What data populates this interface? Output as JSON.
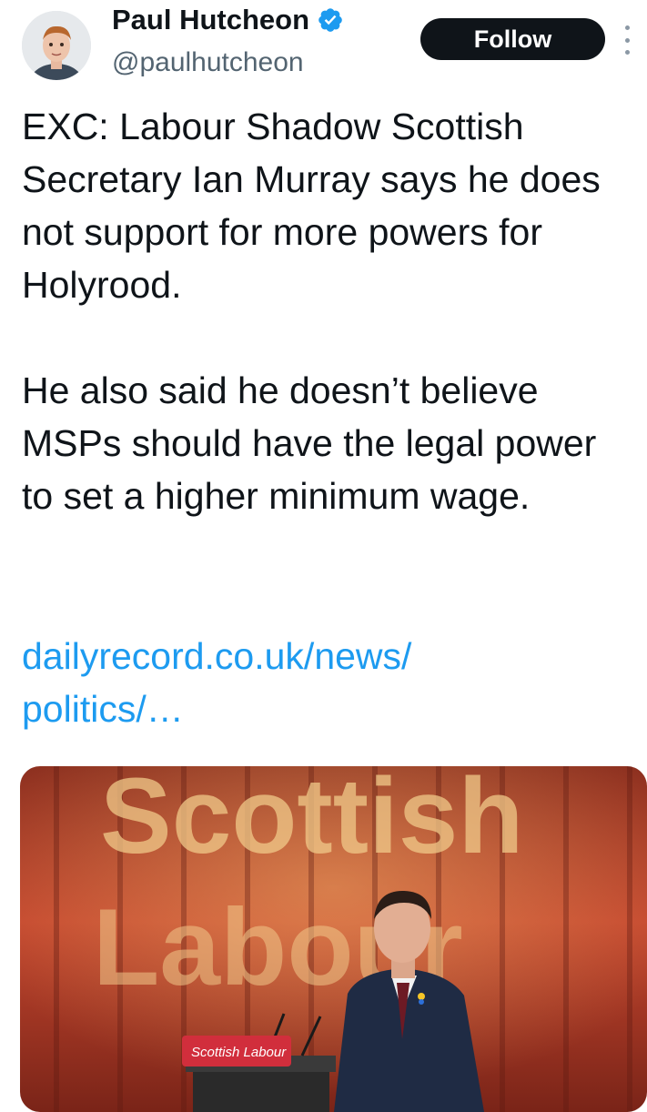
{
  "author": {
    "display_name": "Paul Hutcheon",
    "handle": "@paulhutcheon",
    "avatar_icon": "person-avatar",
    "verified_icon": "verified-badge-icon",
    "verified_color": "#1d9bf0"
  },
  "actions": {
    "follow_label": "Follow",
    "more_icon": "more-vertical-icon"
  },
  "tweet": {
    "paragraphs": [
      "EXC: Labour Shadow Scottish Secretary Ian Murray says he does not support for more powers for Holyrood.",
      "He also said he doesn’t believe MSPs should have the legal power to set a higher minimum wage."
    ],
    "link_text": "dailyrecord.co.uk/news/\npolitics/…",
    "link_color": "#1d9bf0"
  },
  "media": {
    "backdrop_text_line1": "Scottish",
    "backdrop_text_line2": "Labour",
    "lectern_sign": "Scottish Labour",
    "backdrop_color": "#c4462e"
  }
}
